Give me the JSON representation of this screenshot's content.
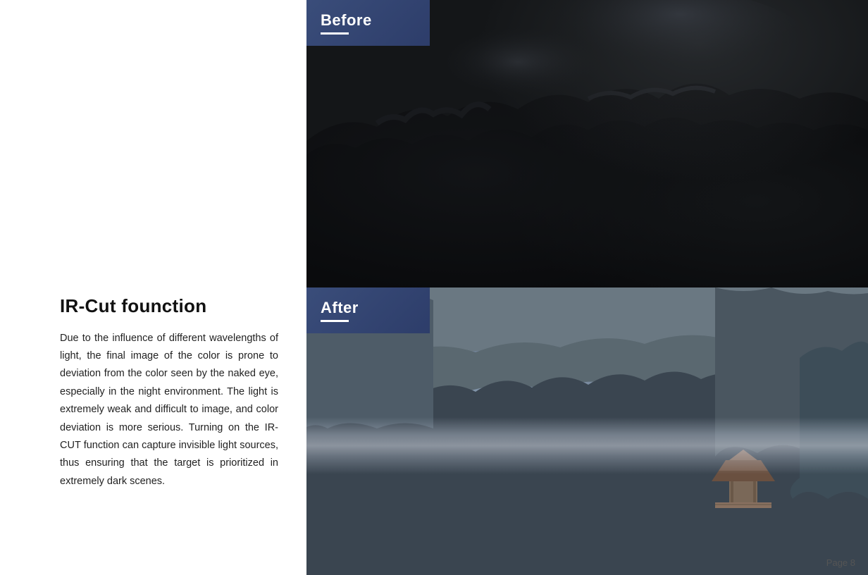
{
  "left": {
    "title": "IR-Cut founction",
    "body": "Due to the influence of different wavelengths of light, the final image of the color is prone to deviation from the color seen by the naked eye, especially in the night environment. The light is extremely weak and difficult to image, and color deviation is more serious. Turning on the IR-CUT function can capture invisible light sources, thus ensuring that the target is prioritized in extremely dark scenes."
  },
  "right": {
    "before_label": "Before",
    "after_label": "After"
  },
  "footer": {
    "page": "Page 8"
  }
}
